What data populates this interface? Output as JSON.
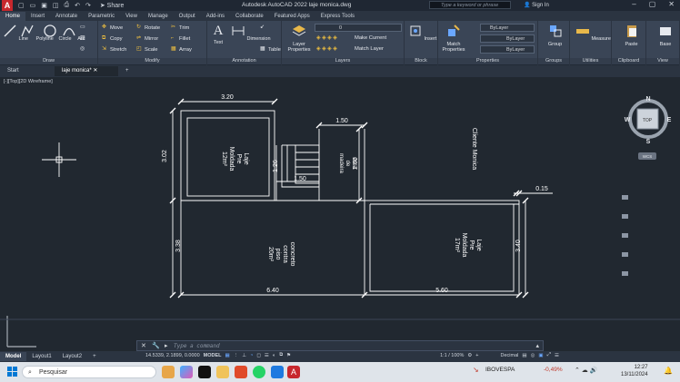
{
  "titlebar": {
    "app_letter": "A",
    "share": "Share",
    "title": "Autodesk AutoCAD 2022   laje monica.dwg",
    "search_placeholder": "Type a keyword or phrase",
    "sign_in": "Sign In"
  },
  "ribbon_tabs": [
    "Home",
    "Insert",
    "Annotate",
    "Parametric",
    "View",
    "Manage",
    "Output",
    "Add-ins",
    "Collaborate",
    "Featured Apps",
    "Express Tools"
  ],
  "ribbon": {
    "draw": {
      "title": "Draw",
      "line": "Line",
      "polyline": "Polyline",
      "circle": "Circle",
      "arc": "Arc"
    },
    "modify": {
      "title": "Modify",
      "move": "Move",
      "rotate": "Rotate",
      "trim": "Trim",
      "copy": "Copy",
      "mirror": "Mirror",
      "fillet": "Fillet",
      "stretch": "Stretch",
      "scale": "Scale",
      "array": "Array"
    },
    "annotation": {
      "title": "Annotation",
      "text": "Text",
      "dimension": "Dimension",
      "table": "Table"
    },
    "layers": {
      "title": "Layers",
      "layer_properties": "Layer Properties",
      "current_layer": "0",
      "make_current": "Make Current",
      "match_layer": "Match Layer"
    },
    "block": {
      "title": "Block",
      "insert": "Insert"
    },
    "properties": {
      "title": "Properties",
      "match": "Match Properties",
      "bylayer1": "ByLayer",
      "bylayer2": "ByLayer",
      "bylayer3": "ByLayer"
    },
    "groups": {
      "title": "Groups",
      "group": "Group"
    },
    "utilities": {
      "title": "Utilities",
      "measure": "Measure"
    },
    "clipboard": {
      "title": "Clipboard",
      "paste": "Paste"
    },
    "view": {
      "title": "View",
      "base": "Base"
    }
  },
  "doc_tabs": [
    "Start",
    "laje monica*"
  ],
  "view_label": "[-][Top][2D Wireframe]",
  "drawing": {
    "dims": {
      "top_width": "3.20",
      "left_top": "3.02",
      "stair_top": "1.50",
      "stair_h": "2.60",
      "inner_h": "1.26",
      "inner_w": "1.50",
      "right_gap": "0.15",
      "left_bottom": "3.38",
      "bottom_left": "6.40",
      "bottom_right": "5.60",
      "right_h": "3.40"
    },
    "labels": {
      "slab1": [
        "Laje",
        "Pre",
        "Moldada",
        "12m²"
      ],
      "stair": [
        "Area",
        "de",
        "madeira"
      ],
      "concrete": [
        "concreto",
        "contra",
        "piso",
        "20m²"
      ],
      "slab2": [
        "Laje",
        "Pre",
        "Moldada",
        "17m²"
      ],
      "client": "Cliente Monica"
    }
  },
  "viewcube": {
    "n": "N",
    "s": "S",
    "e": "E",
    "w": "W",
    "top": "TOP",
    "wcs": "WCS"
  },
  "command_placeholder": "Type a command",
  "layout_tabs": [
    "Model",
    "Layout1",
    "Layout2"
  ],
  "status": {
    "coords": "14.5339, 2.1899, 0.0000",
    "model": "MODEL",
    "scale": "1:1 / 100%",
    "units": "Decimal"
  },
  "taskbar": {
    "search": "Pesquisar",
    "stock_name": "IBOVESPA",
    "stock_change": "-0,49%",
    "time": "12:27",
    "date": "13/11/2024"
  },
  "colors": {
    "accent": "#c7272d",
    "ribbon": "#3a4556",
    "canvas": "#212830",
    "taskbar": "#dfe4ea"
  }
}
